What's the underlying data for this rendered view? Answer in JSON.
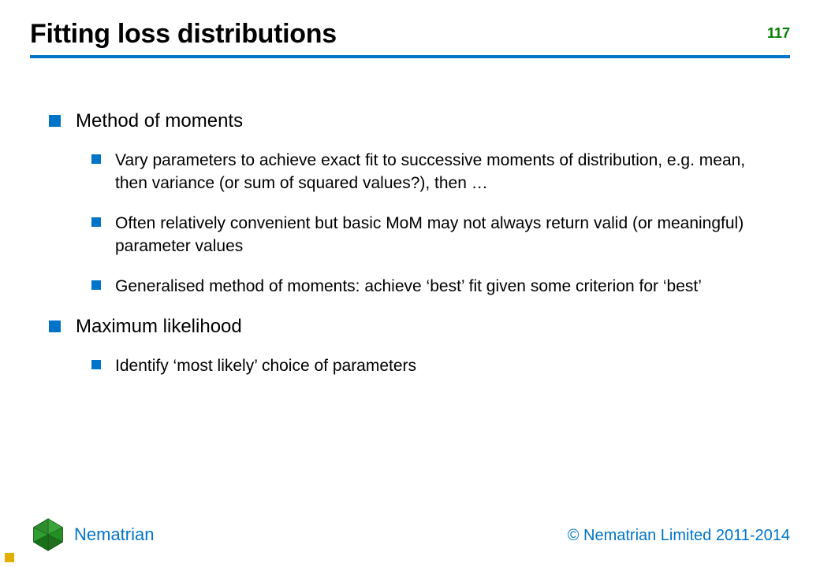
{
  "header": {
    "title": "Fitting loss distributions",
    "page_number": "117"
  },
  "bullets": [
    {
      "text": "Method of moments",
      "sub": [
        "Vary parameters to achieve exact fit to successive moments of distribution, e.g. mean, then variance (or sum of squared values?), then …",
        "Often relatively convenient but basic MoM may not always return valid (or meaningful) parameter values",
        "Generalised method of moments: achieve ‘best’ fit given some criterion for ‘best’"
      ]
    },
    {
      "text": "Maximum likelihood",
      "sub": [
        "Identify ‘most likely’ choice of parameters"
      ]
    }
  ],
  "footer": {
    "brand": "Nematrian",
    "copyright": "© Nematrian Limited 2011-2014"
  }
}
